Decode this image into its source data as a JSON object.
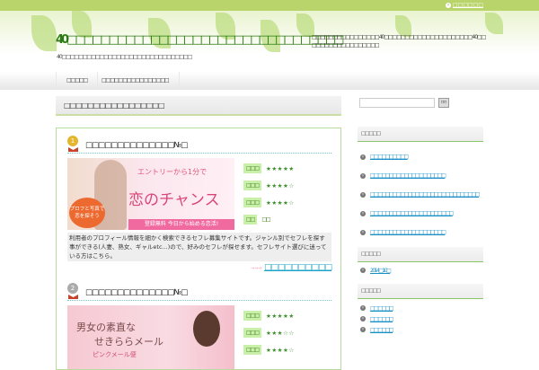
{
  "topbar": {
    "link": "□□□□□□"
  },
  "header": {
    "title": "40□□□□□□□□□□□□□□□□□□□□□□□□□□□□□□□□□",
    "subtitle": "40□□□□□□□□□□□□□□□□□□□□□□□□□□□□□□□",
    "description": "□□□□□□□□□□□□□□□□40□□□□□□□□□□□□□□□□□□□□□40□□□□□□□□□□□□□□□□□□"
  },
  "nav": [
    "□□□□□",
    "□□□□□□□□□□□□□□□□"
  ],
  "main": {
    "page_title": "□□□□□□□□□□□□□□□□□",
    "entries": [
      {
        "rank": "1",
        "title": "□□□□□□□□□□□□□□№□",
        "banner": {
          "line1": "エントリーから1分で",
          "line2": "恋のチャンス",
          "line3": "登録無料 今日から始める恋活!",
          "badge": "プロフと写真で恋を探そう"
        },
        "ratings": [
          {
            "label": "□□□",
            "stars": "★★★★★"
          },
          {
            "label": "□□□",
            "stars": "★★★★☆"
          },
          {
            "label": "□□□",
            "stars": "★★★★☆"
          },
          {
            "label": "□□",
            "value": "□□"
          }
        ],
        "text": "利用者のプロフィール情報を細かく検索できるセフレ募集サイトです。ジャンル別でセフレを探す事ができる(人妻、熟女、ギャルetc...)ので、好みのセフレが探せます。セフレサイト選びに迷っている方はこちら。",
        "arrow": "⇒⇒⇒",
        "link": "□□□□□□□□□□"
      },
      {
        "rank": "2",
        "title": "□□□□□□□□□□□□□□№□",
        "banner": {
          "line1": "男女の素直な",
          "line2": "せきららメール",
          "line3": "ピンクメール便"
        },
        "ratings": [
          {
            "label": "□□□",
            "stars": "★★★★★"
          },
          {
            "label": "□□□",
            "stars": "★★★☆☆"
          },
          {
            "label": "□□□",
            "stars": "★★★★☆"
          }
        ]
      }
    ]
  },
  "sidebar": {
    "search_button": "□□",
    "widgets": [
      {
        "title": "□□□□□",
        "items": [
          "□□□□□□□□□□",
          "□□□□□□□□□□□□□□□□□□□□",
          "□□□□□□□□□□□□□□□□□□□□□□□□□□□□□",
          "□□□□□□□□□□□□□□□□□□□□□□",
          "□□□□□□□□□□□□□□□□□□□□"
        ]
      },
      {
        "title": "□□□□□",
        "items": [
          "2014□10□"
        ]
      },
      {
        "title": "□□□□□",
        "items": [
          "□□□□□□",
          "□□□□□□",
          "□□□□□□"
        ]
      }
    ]
  }
}
